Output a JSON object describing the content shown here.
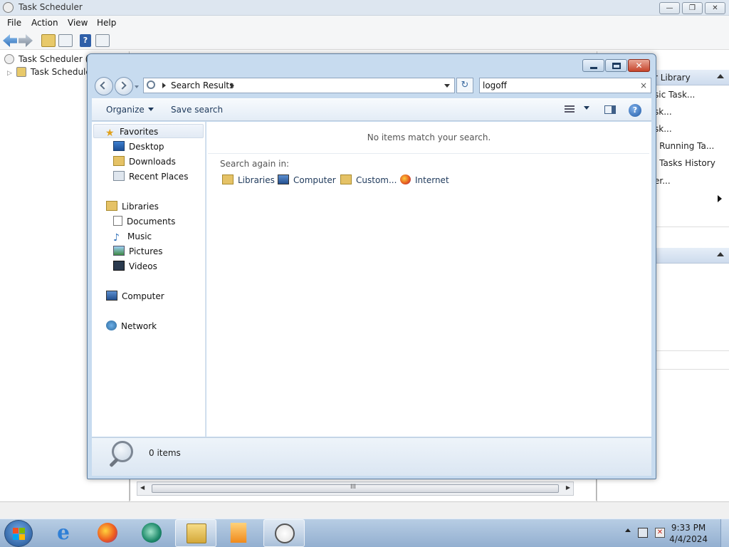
{
  "task_scheduler": {
    "title": "Task Scheduler",
    "menu": [
      "File",
      "Action",
      "View",
      "Help"
    ],
    "tree": [
      "Task Scheduler (Lo",
      "Task Scheduler"
    ],
    "actions_header": "r Library",
    "actions": [
      "sic Task...",
      "sk...",
      "sk...",
      "l Running Ta...",
      "l Tasks History",
      "er..."
    ],
    "scroll_grip": "III"
  },
  "explorer": {
    "address": {
      "crumb": "Search Results"
    },
    "search": {
      "value": "logoff",
      "clear": "×"
    },
    "refresh_glyph": "↻",
    "commands": {
      "organize": "Organize",
      "save_search": "Save search",
      "help": "?"
    },
    "nav": {
      "favorites": "Favorites",
      "desktop": "Desktop",
      "downloads": "Downloads",
      "recent_places": "Recent Places",
      "libraries": "Libraries",
      "documents": "Documents",
      "music": "Music",
      "pictures": "Pictures",
      "videos": "Videos",
      "computer": "Computer",
      "network": "Network"
    },
    "content": {
      "no_items": "No items match your search.",
      "search_again": "Search again in:",
      "again_items": [
        "Libraries",
        "Computer",
        "Custom...",
        "Internet"
      ]
    },
    "details": {
      "count": "0 items"
    }
  },
  "taskbar": {
    "clock_time": "9:33 PM",
    "clock_date": "4/4/2024"
  }
}
